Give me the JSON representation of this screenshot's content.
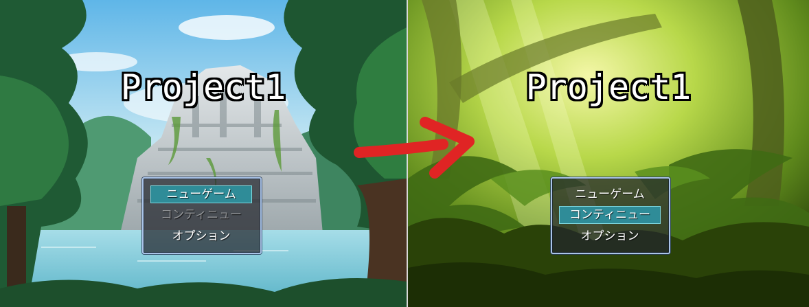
{
  "comparison": {
    "before": {
      "title": "Project1",
      "menu": [
        {
          "label": "ニューゲーム",
          "state": "selected"
        },
        {
          "label": "コンティニュー",
          "state": "disabled"
        },
        {
          "label": "オプション",
          "state": "normal"
        }
      ],
      "background": "ruined-temple-lake"
    },
    "after": {
      "title": "Project1",
      "menu": [
        {
          "label": "ニューゲーム",
          "state": "normal"
        },
        {
          "label": "コンティニュー",
          "state": "selected"
        },
        {
          "label": "オプション",
          "state": "normal"
        }
      ],
      "background": "jungle"
    },
    "arrow": {
      "icon": "right-arrow-icon",
      "color": "#e02424"
    }
  },
  "colors": {
    "selection": "#2f8c98",
    "window_border": "#aac4e8"
  }
}
